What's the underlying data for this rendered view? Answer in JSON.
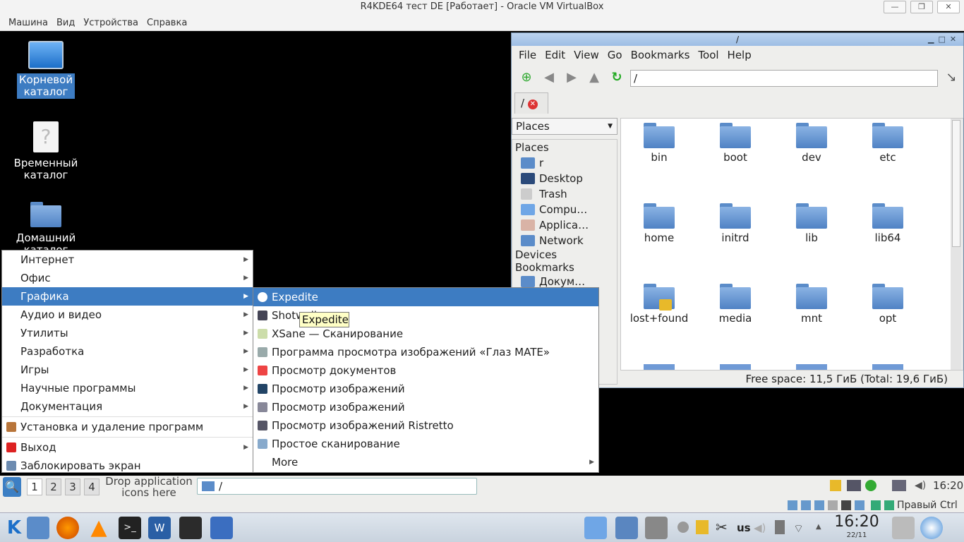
{
  "vbox": {
    "title": "R4KDE64 тест DE [Работает] - Oracle VM VirtualBox",
    "menu": [
      "Машина",
      "Вид",
      "Устройства",
      "Справка"
    ],
    "status_right": "Правый Ctrl"
  },
  "desktop": {
    "icons": [
      {
        "label1": "Корневой",
        "label2": "каталог"
      },
      {
        "label1": "Временный",
        "label2": "каталог"
      },
      {
        "label1": "Домашний",
        "label2": "каталог"
      }
    ]
  },
  "filemanager": {
    "title": "/",
    "menu": [
      "File",
      "Edit",
      "View",
      "Go",
      "Bookmarks",
      "Tool",
      "Help"
    ],
    "address": "/",
    "tab": "/",
    "places_dropdown": "Places",
    "sidebar": {
      "header_places": "Places",
      "places": [
        "r",
        "Desktop",
        "Trash",
        "Compu…",
        "Applica…",
        "Network"
      ],
      "header_devices": "Devices",
      "header_bookmarks": "Bookmarks",
      "bookmarks": [
        "Докум…"
      ]
    },
    "folders": [
      "bin",
      "boot",
      "dev",
      "etc",
      "home",
      "initrd",
      "lib",
      "lib64",
      "lost+found",
      "media",
      "mnt",
      "opt"
    ],
    "status": "Free space: 11,5 ГиБ (Total: 19,6 ГиБ)"
  },
  "app_menu": {
    "categories": [
      "Интернет",
      "Офис",
      "Графика",
      "Аудио и видео",
      "Утилиты",
      "Разработка",
      "Игры",
      "Научные программы",
      "Документация"
    ],
    "install": "Установка и удаление программ",
    "logout": "Выход",
    "lock": "Заблокировать экран"
  },
  "graphics_menu": {
    "items": [
      "Expedite",
      "Shotwell",
      "XSane — Сканирование",
      "Программа просмотра изображений «Глаз MATE»",
      "Просмотр документов",
      "Просмотр изображений",
      "Просмотр изображений",
      "Просмотр изображений Ristretto",
      "Простое сканирование",
      "More"
    ]
  },
  "tooltip": "Expedite",
  "guest_panel": {
    "workspaces": [
      "1",
      "2",
      "3",
      "4"
    ],
    "drop_text1": "Drop application",
    "drop_text2": "icons here",
    "task": "/",
    "clock": "16:20"
  },
  "host_tray": {
    "lang": "us",
    "clock": "16:20",
    "date": "22/11"
  }
}
